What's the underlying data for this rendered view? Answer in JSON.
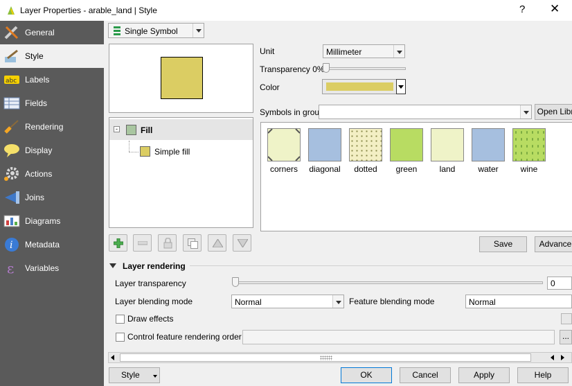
{
  "window": {
    "title": "Layer Properties - arable_land | Style",
    "help": "?",
    "close": "✕"
  },
  "sidebar": {
    "items": [
      {
        "label": "General",
        "icon": "wrench-screwdriver-icon"
      },
      {
        "label": "Style",
        "icon": "paint-brush-icon"
      },
      {
        "label": "Labels",
        "icon": "abc-label-icon"
      },
      {
        "label": "Fields",
        "icon": "table-icon"
      },
      {
        "label": "Rendering",
        "icon": "brush-icon"
      },
      {
        "label": "Display",
        "icon": "speech-bubble-icon"
      },
      {
        "label": "Actions",
        "icon": "gear-icon"
      },
      {
        "label": "Joins",
        "icon": "join-icon"
      },
      {
        "label": "Diagrams",
        "icon": "chart-icon"
      },
      {
        "label": "Metadata",
        "icon": "info-icon"
      },
      {
        "label": "Variables",
        "icon": "epsilon-icon"
      }
    ],
    "active": "Style"
  },
  "renderer": {
    "value": "Single Symbol"
  },
  "symbol": {
    "fill_color": "#dbcd63",
    "tree": {
      "root": "Fill",
      "child": "Simple fill"
    },
    "unit_label": "Unit",
    "unit_value": "Millimeter",
    "transparency_label": "Transparency 0%",
    "color_label": "Color"
  },
  "library": {
    "label": "Symbols in group",
    "group_value": "",
    "open_button": "Open Libr",
    "symbols": [
      {
        "label": "corners",
        "color": "#eff3c8"
      },
      {
        "label": "diagonal",
        "color": "#a6bfdf"
      },
      {
        "label": "dotted",
        "color": "#f3efc4"
      },
      {
        "label": "green",
        "color": "#b8dc62"
      },
      {
        "label": "land",
        "color": "#eff3c8"
      },
      {
        "label": "water",
        "color": "#a6bfdf"
      },
      {
        "label": "wine",
        "color": "#b8dc62"
      }
    ],
    "save_button": "Save",
    "advanced_button": "Advance"
  },
  "layer_rendering": {
    "header": "Layer rendering",
    "transparency_label": "Layer transparency",
    "transparency_value": "0",
    "blend_label": "Layer blending mode",
    "blend_value": "Normal",
    "feature_blend_label": "Feature blending mode",
    "feature_blend_value": "Normal",
    "draw_effects": "Draw effects",
    "control_order": "Control feature rendering order",
    "more": "..."
  },
  "footer": {
    "style_button": "Style",
    "ok": "OK",
    "cancel": "Cancel",
    "apply": "Apply",
    "help": "Help"
  }
}
